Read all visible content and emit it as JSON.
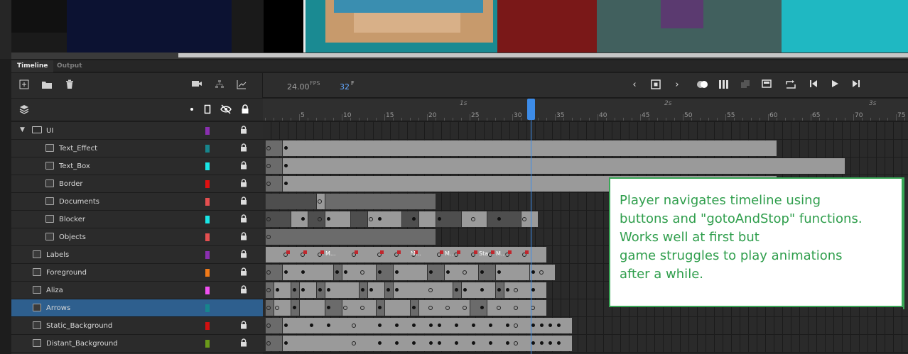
{
  "tabs": {
    "timeline": "Timeline",
    "output": "Output"
  },
  "toolbar": {
    "left_icons": [
      "new-layer-icon",
      "new-folder-icon",
      "delete-icon",
      "camera-icon",
      "layer-parenting-icon",
      "graph-icon"
    ],
    "fps_value": "24.00",
    "fps_unit": "FPS",
    "frame_value": "32",
    "frame_unit": "F",
    "playback_icons": [
      "prev-icon",
      "center-icon",
      "next-icon",
      "onion-skin-icon",
      "onion-outline-icon",
      "edit-multiple-icon",
      "frame-span-icon",
      "loop-icon",
      "step-back-icon",
      "play-icon",
      "step-forward-icon"
    ]
  },
  "ruler": {
    "numbers": [
      "5",
      "10",
      "15",
      "20",
      "25",
      "30",
      "35",
      "40",
      "45",
      "50",
      "55",
      "60",
      "65",
      "70",
      "75"
    ],
    "seconds": [
      "1s",
      "2s",
      "3s"
    ],
    "current_frame": 32
  },
  "layers": [
    {
      "name": "UI",
      "type": "folder",
      "indent": 0,
      "color": "#8a2fb0",
      "locked": true
    },
    {
      "name": "Text_Effect",
      "type": "layer",
      "indent": 2,
      "color": "#17858c",
      "locked": true
    },
    {
      "name": "Text_Box",
      "type": "layer",
      "indent": 2,
      "color": "#19e6e6",
      "locked": true
    },
    {
      "name": "Border",
      "type": "layer",
      "indent": 2,
      "color": "#e01010",
      "locked": true
    },
    {
      "name": "Documents",
      "type": "layer",
      "indent": 2,
      "color": "#e54f50",
      "locked": true
    },
    {
      "name": "Blocker",
      "type": "layer",
      "indent": 2,
      "color": "#19e6e6",
      "locked": true
    },
    {
      "name": "Objects",
      "type": "layer",
      "indent": 2,
      "color": "#e54f50",
      "locked": true
    },
    {
      "name": "Labels",
      "type": "layer",
      "indent": 1,
      "color": "#8a2fb0",
      "locked": true
    },
    {
      "name": "Foreground",
      "type": "layer",
      "indent": 1,
      "color": "#f07a18",
      "locked": true
    },
    {
      "name": "Aliza",
      "type": "layer",
      "indent": 1,
      "color": "#f050f0",
      "locked": true
    },
    {
      "name": "Arrows",
      "type": "layer",
      "indent": 1,
      "color": "#17858c",
      "locked": false,
      "selected": true
    },
    {
      "name": "Static_Background",
      "type": "layer",
      "indent": 1,
      "color": "#d01010",
      "locked": true
    },
    {
      "name": "Distant_Background",
      "type": "layer",
      "indent": 1,
      "color": "#6a9a1a",
      "locked": true
    }
  ],
  "frame_labels": [
    "M...",
    "M...",
    "M...",
    "Sta...",
    "M..."
  ],
  "annotation": {
    "text": "Player navigates timeline using\nbuttons and \"gotoAndStop\" functions.\nWorks well at first but\ngame struggles to play animations\nafter a while."
  }
}
